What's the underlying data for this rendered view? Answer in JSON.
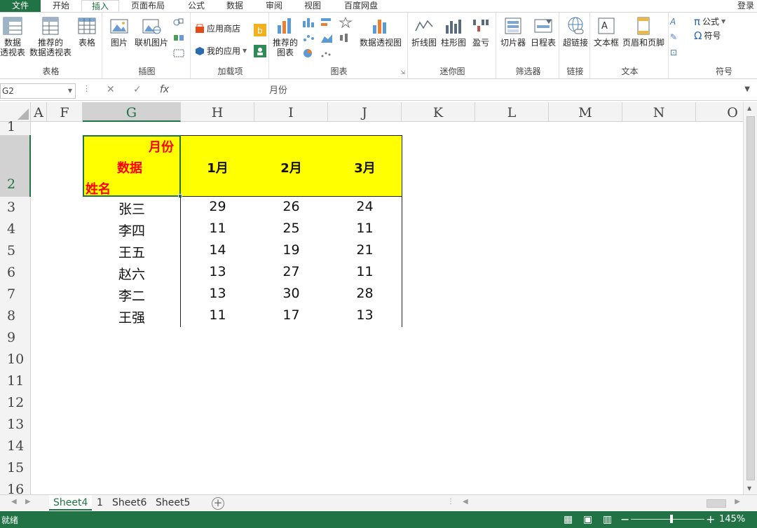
{
  "ribbon_tabs": [
    {
      "label": "文件"
    },
    {
      "label": "开始"
    },
    {
      "label": "插入"
    },
    {
      "label": "页面布局"
    },
    {
      "label": "公式"
    },
    {
      "label": "数据"
    },
    {
      "label": "审阅"
    },
    {
      "label": "视图"
    },
    {
      "label": "百度网盘"
    }
  ],
  "login": "登录",
  "ribbon": {
    "tables": {
      "label": "表格",
      "pivot_line1": "数据",
      "pivot_line2": "透视表",
      "rec_pivot_line1": "推荐的",
      "rec_pivot_line2": "数据透视表",
      "table": "表格"
    },
    "illustrations": {
      "label": "插图",
      "picture": "图片",
      "online_picture": "联机图片"
    },
    "addins": {
      "label": "加载项",
      "store": "应用商店",
      "my_apps": "我的应用"
    },
    "charts": {
      "label": "图表",
      "rec_charts_line1": "推荐的",
      "rec_charts_line2": "图表",
      "pivot_chart": "数据透视图"
    },
    "sparklines": {
      "label": "迷你图",
      "line": "折线图",
      "column": "柱形图",
      "winloss": "盈亏"
    },
    "filters": {
      "label": "筛选器",
      "slicer": "切片器",
      "timeline": "日程表"
    },
    "links": {
      "label": "链接",
      "hyperlink": "超链接"
    },
    "text": {
      "label": "文本",
      "textbox": "文本框",
      "header_footer": "页眉和页脚"
    },
    "symbols": {
      "label": "符号",
      "equation": "公式",
      "symbol": "符号"
    }
  },
  "formula_bar": {
    "name_box": "G2",
    "content": "月份"
  },
  "columns": [
    "A",
    "F",
    "G",
    "H",
    "I",
    "J",
    "K",
    "L",
    "M",
    "N",
    "O"
  ],
  "rows": [
    "1",
    "2",
    "3",
    "4",
    "5",
    "6",
    "7",
    "8",
    "9",
    "10",
    "11",
    "12",
    "13",
    "14",
    "15",
    "16"
  ],
  "table": {
    "header_month": "月份",
    "header_data": "数据",
    "header_name": "姓名",
    "months": [
      "1月",
      "2月",
      "3月"
    ],
    "data": [
      {
        "name": "张三",
        "values": [
          "29",
          "26",
          "24"
        ]
      },
      {
        "name": "李四",
        "values": [
          "11",
          "25",
          "11"
        ]
      },
      {
        "name": "王五",
        "values": [
          "14",
          "19",
          "21"
        ]
      },
      {
        "name": "赵六",
        "values": [
          "13",
          "27",
          "11"
        ]
      },
      {
        "name": "李二",
        "values": [
          "13",
          "30",
          "28"
        ]
      },
      {
        "name": "王强",
        "values": [
          "11",
          "17",
          "13"
        ]
      }
    ]
  },
  "sheets": [
    "Sheet4",
    "1",
    "Sheet6",
    "Sheet5"
  ],
  "status": {
    "text": "就绪",
    "zoom": "145%"
  },
  "colors": {
    "excel_green": "#217346",
    "header_fill": "#ffff00",
    "header_text_red": "#ff0000"
  }
}
